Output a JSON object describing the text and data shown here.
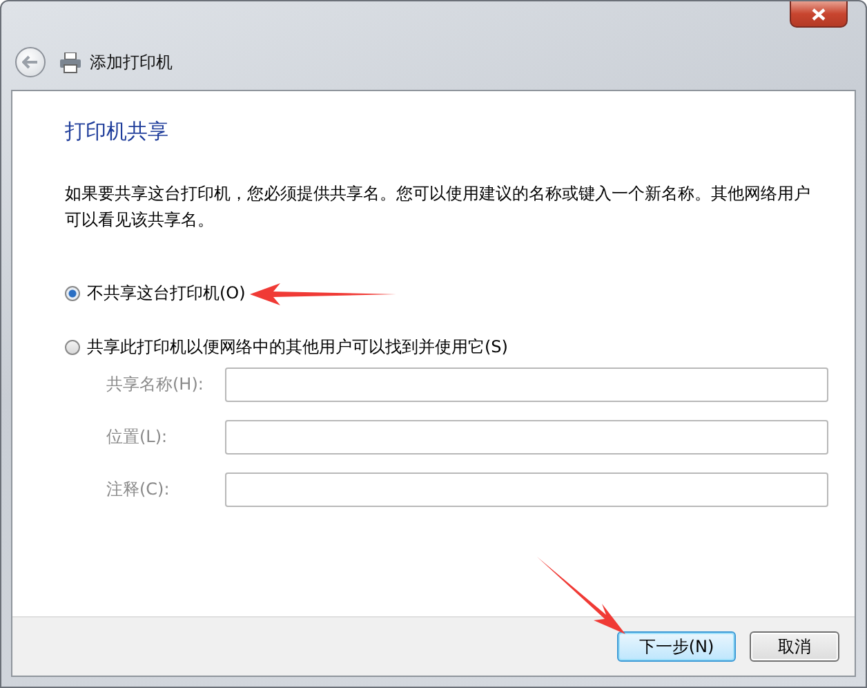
{
  "window": {
    "title": "添加打印机"
  },
  "heading": "打印机共享",
  "description": "如果要共享这台打印机，您必须提供共享名。您可以使用建议的名称或键入一个新名称。其他网络用户可以看见该共享名。",
  "options": [
    {
      "label": "不共享这台打印机(O)",
      "selected": true
    },
    {
      "label": "共享此打印机以便网络中的其他用户可以找到并使用它(S)",
      "selected": false
    }
  ],
  "fields": [
    {
      "label": "共享名称(H):",
      "disabled": true
    },
    {
      "label": "位置(L):",
      "disabled": true
    },
    {
      "label": "注释(C):",
      "disabled": true
    }
  ],
  "buttons": [
    {
      "label": "下一步(N)",
      "kind": "default"
    },
    {
      "label": "取消",
      "kind": "normal"
    }
  ]
}
